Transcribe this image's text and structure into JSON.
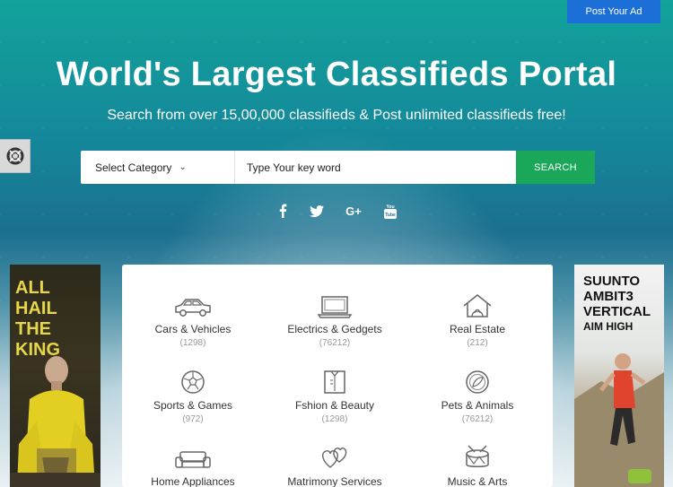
{
  "header": {
    "post_ad_label": "Post Your Ad",
    "title": "World's Largest Classifieds Portal",
    "subtitle": "Search from over 15,00,000 classifieds & Post unlimited classifieds free!"
  },
  "search": {
    "category_label": "Select Category",
    "placeholder": "Type Your key word",
    "button_label": "SEARCH"
  },
  "socials": [
    {
      "icon": "facebook-icon",
      "glyph": "f"
    },
    {
      "icon": "twitter-icon",
      "glyph": "t"
    },
    {
      "icon": "google-plus-icon",
      "glyph": "G+"
    },
    {
      "icon": "youtube-icon",
      "glyph": "You"
    }
  ],
  "ads": {
    "left_text": "ALL HAIL THE KING",
    "right_text_1": "SUUNTO",
    "right_text_2": "AMBIT3",
    "right_text_3": "VERTICAL",
    "right_text_4": "AIM HIGH"
  },
  "categories": [
    {
      "name": "Cars & Vehicles",
      "count": "(1298)",
      "icon": "car-icon"
    },
    {
      "name": "Electrics & Gedgets",
      "count": "(76212)",
      "icon": "laptop-icon"
    },
    {
      "name": "Real Estate",
      "count": "(212)",
      "icon": "house-icon"
    },
    {
      "name": "Sports & Games",
      "count": "(972)",
      "icon": "soccer-ball-icon"
    },
    {
      "name": "Fshion & Beauty",
      "count": "(1298)",
      "icon": "shirt-icon"
    },
    {
      "name": "Pets & Animals",
      "count": "(76212)",
      "icon": "pet-icon"
    },
    {
      "name": "Home Appliances",
      "count": "",
      "icon": "sofa-icon"
    },
    {
      "name": "Matrimony Services",
      "count": "",
      "icon": "hearts-icon"
    },
    {
      "name": "Music & Arts",
      "count": "",
      "icon": "drum-icon"
    }
  ]
}
